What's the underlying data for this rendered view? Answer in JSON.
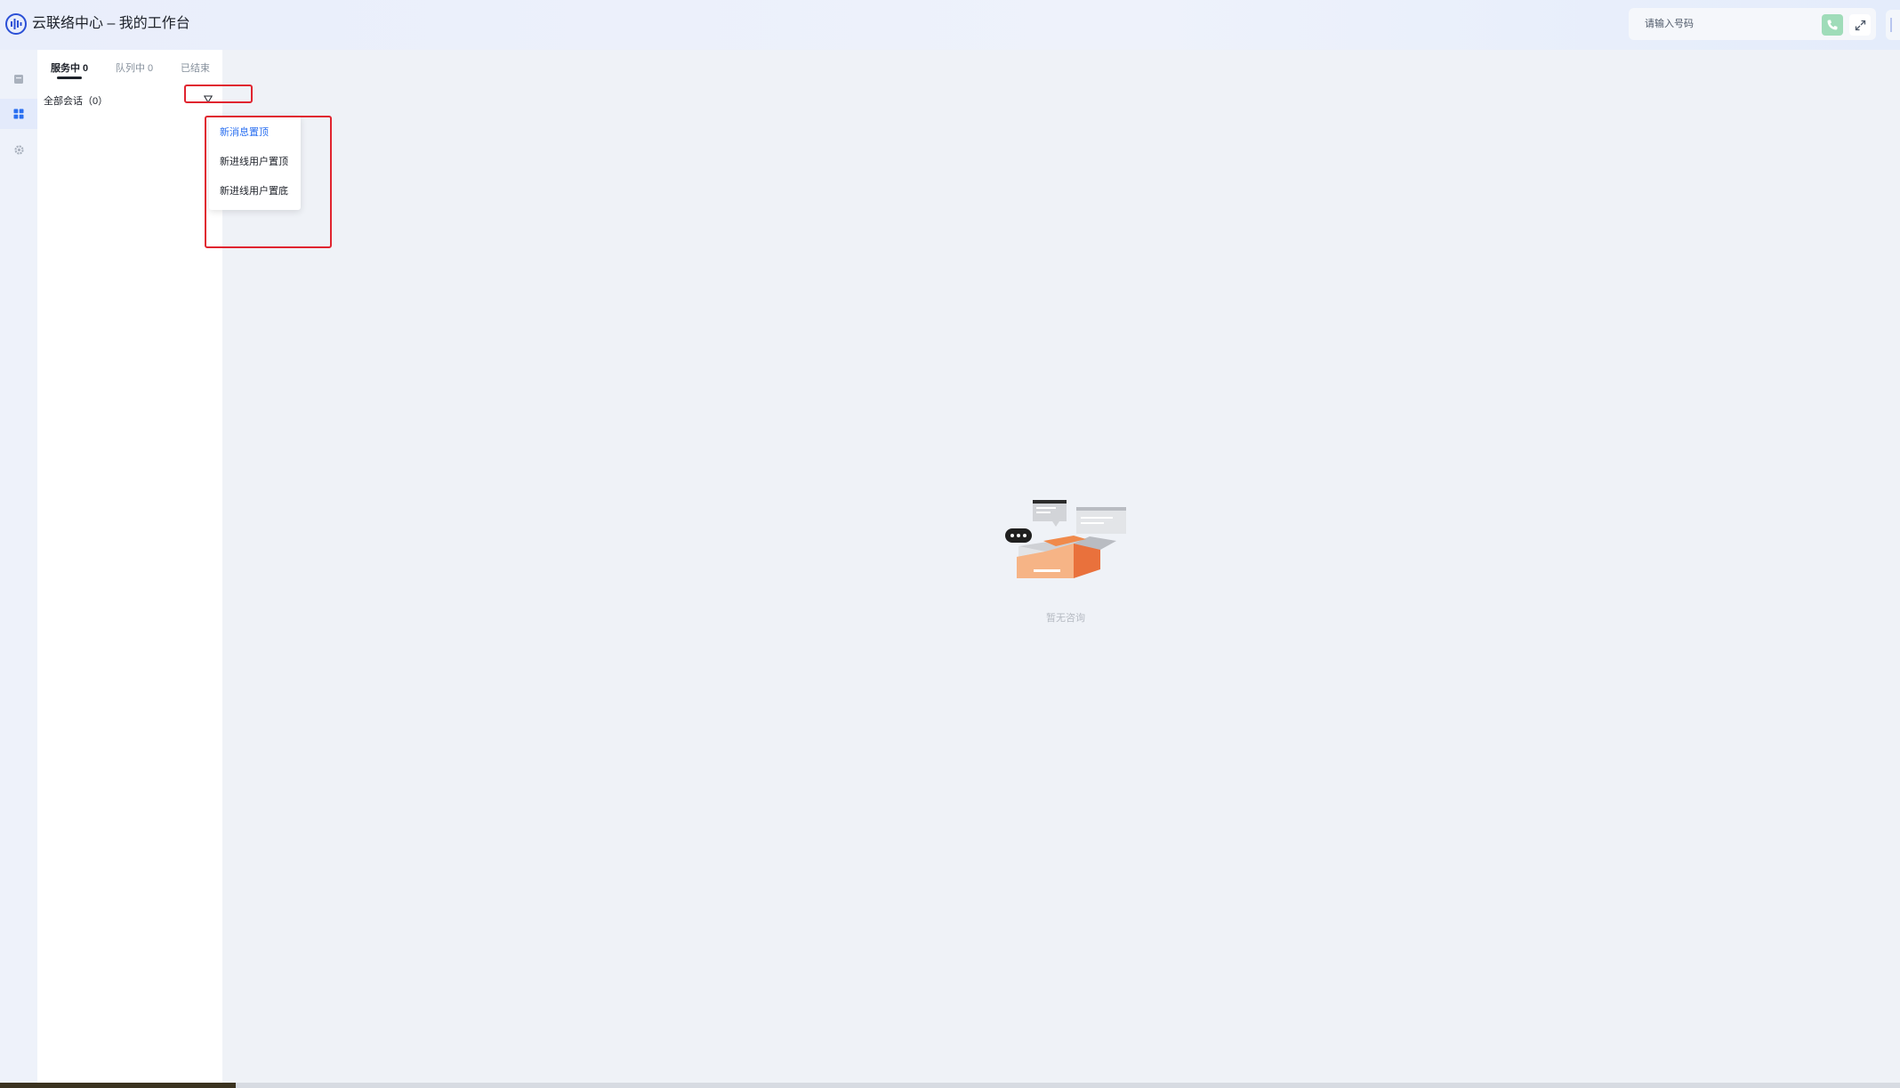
{
  "app": {
    "title": "云联络中心 – 我的工作台",
    "accent_color": "#2a6ff0"
  },
  "dialer": {
    "placeholder": "请输入号码",
    "call_icon": "phone-icon",
    "expand_icon": "expand-icon"
  },
  "sidenav": {
    "items": [
      {
        "icon": "inbox-icon",
        "active": false
      },
      {
        "icon": "grid-icon",
        "active": true
      },
      {
        "icon": "gear-icon",
        "active": false
      }
    ]
  },
  "conversations": {
    "tabs": [
      {
        "label": "服务中 0",
        "active": true
      },
      {
        "label": "队列中 0",
        "active": false
      },
      {
        "label": "已结束",
        "active": false
      }
    ],
    "all_label": "全部会话（0）",
    "filter_icon": "filter-icon"
  },
  "sort_menu": {
    "items": [
      {
        "label": "新消息置顶",
        "selected": true
      },
      {
        "label": "新进线用户置顶",
        "selected": false
      },
      {
        "label": "新进线用户置底",
        "selected": false
      }
    ]
  },
  "main": {
    "empty_text": "暂无咨询"
  },
  "highlight_color": "#e0242f"
}
